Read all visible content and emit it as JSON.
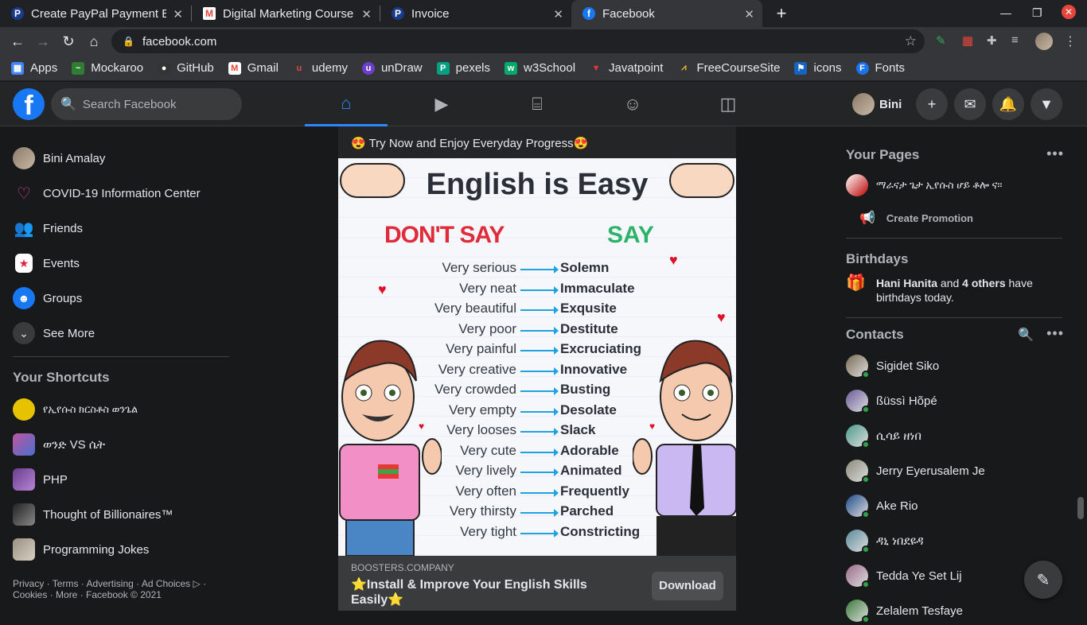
{
  "browser": {
    "tabs": [
      {
        "title": "Create PayPal Payment Bu",
        "icon": "paypal-icon",
        "color": "#ffffff",
        "glyph": "P"
      },
      {
        "title": "Digital Marketing Course",
        "icon": "gmail-icon",
        "color": "#ea4335",
        "glyph": "M"
      },
      {
        "title": "Invoice",
        "icon": "paypal-icon",
        "color": "#ffffff",
        "glyph": "P"
      },
      {
        "title": "Facebook",
        "icon": "facebook-icon",
        "color": "#1877f2",
        "glyph": "f"
      }
    ],
    "url": "facebook.com",
    "bookmarks": [
      {
        "label": "Apps",
        "icon": "apps-grid-icon",
        "color": "#4285f4",
        "glyph": "⋮"
      },
      {
        "label": "Mockaroo",
        "icon": "mockaroo-icon",
        "color": "#2e7d32",
        "glyph": "~"
      },
      {
        "label": "GitHub",
        "icon": "github-icon",
        "color": "#333333",
        "glyph": "●"
      },
      {
        "label": "Gmail",
        "icon": "gmail-icon",
        "color": "#ea4335",
        "glyph": "M"
      },
      {
        "label": "udemy",
        "icon": "udemy-icon",
        "color": "#c0392b",
        "glyph": "u"
      },
      {
        "label": "unDraw",
        "icon": "undraw-icon",
        "color": "#6c3fc9",
        "glyph": "u"
      },
      {
        "label": "pexels",
        "icon": "pexels-icon",
        "color": "#05a081",
        "glyph": "P"
      },
      {
        "label": "w3School",
        "icon": "w3school-icon",
        "color": "#04aa6d",
        "glyph": "w"
      },
      {
        "label": "Javatpoint",
        "icon": "javatpoint-icon",
        "color": "#c62828",
        "glyph": "▼"
      },
      {
        "label": "FreeCourseSite",
        "icon": "freecoursesite-icon",
        "color": "#444444",
        "glyph": "⩘"
      },
      {
        "label": "icons",
        "icon": "icons-flag-icon",
        "color": "#1565c0",
        "glyph": "▶"
      },
      {
        "label": "Fonts",
        "icon": "fonts-icon",
        "color": "#1a73e8",
        "glyph": "F"
      }
    ]
  },
  "fb": {
    "search_placeholder": "Search Facebook",
    "profile_name": "Bini"
  },
  "left": {
    "items": [
      {
        "label": "Bini Amalay",
        "icon": "avatar",
        "color": "#8a7a6a"
      },
      {
        "label": "COVID-19 Information Center",
        "icon": "covid-info-icon",
        "color": "#c13584"
      },
      {
        "label": "Friends",
        "icon": "friends-icon",
        "color": "#1877f2"
      },
      {
        "label": "Events",
        "icon": "events-icon",
        "color": "#e41e3f"
      },
      {
        "label": "Groups",
        "icon": "groups-icon",
        "color": "#1877f2"
      },
      {
        "label": "See More",
        "icon": "chevron-down-icon",
        "color": "#3a3b3c"
      }
    ],
    "shortcuts_title": "Your Shortcuts",
    "shortcuts": [
      {
        "label": "የኢየሱስ ክርስቶስ ወንጌል",
        "color": "#e6c200"
      },
      {
        "label": "ወንድ VS ሴት",
        "color": "#c0559e"
      },
      {
        "label": "PHP",
        "color": "#6a3e8f"
      },
      {
        "label": "Thought of Billionaires™",
        "color": "#555555"
      },
      {
        "label": "Programming Jokes",
        "color": "#9a8f80"
      }
    ],
    "footer": "Privacy · Terms · Advertising · Ad Choices ▷ · Cookies · More · Facebook © 2021"
  },
  "post": {
    "top_text": "😍 Try Now and Enjoy Everyday Progress😍",
    "image_title": "English is Easy",
    "dont_say": "DON'T SAY",
    "say": "SAY",
    "pairs": [
      {
        "a": "Very serious",
        "b": "Solemn"
      },
      {
        "a": "Very neat",
        "b": "Immaculate"
      },
      {
        "a": "Very beautiful",
        "b": "Exqusite"
      },
      {
        "a": "Very poor",
        "b": "Destitute"
      },
      {
        "a": "Very painful",
        "b": "Excruciating"
      },
      {
        "a": "Very creative",
        "b": "Innovative"
      },
      {
        "a": "Very crowded",
        "b": "Busting"
      },
      {
        "a": "Very empty",
        "b": "Desolate"
      },
      {
        "a": "Very looses",
        "b": "Slack"
      },
      {
        "a": "Very cute",
        "b": "Adorable"
      },
      {
        "a": "Very lively",
        "b": "Animated"
      },
      {
        "a": "Very often",
        "b": "Frequently"
      },
      {
        "a": "Very thirsty",
        "b": "Parched"
      },
      {
        "a": "Very tight",
        "b": "Constricting"
      }
    ],
    "source": "BOOSTERS.COMPANY",
    "headline": "⭐Install & Improve Your English Skills Easily⭐",
    "button": "Download"
  },
  "right": {
    "pages_title": "Your Pages",
    "page_name": "ማራናታ ጌታ ኢየሱስ ሆይ ቶሎ ና።",
    "create_promotion": "Create Promotion",
    "birthdays_title": "Birthdays",
    "birthday_name": "Hani Hanita",
    "birthday_and": " and ",
    "birthday_others": "4 others",
    "birthday_rest": " have birthdays today.",
    "contacts_title": "Contacts",
    "contacts": [
      {
        "name": "Sigidet Siko",
        "color": "#7a6a55"
      },
      {
        "name": "ßüssì Hõpé",
        "color": "#6a5a9a"
      },
      {
        "name": "ሲሳይ ዘነበ",
        "color": "#4a9a8a"
      },
      {
        "name": "Jerry Eyerusalem Je",
        "color": "#8a8a7a"
      },
      {
        "name": "Ake Rio",
        "color": "#1e4a8a"
      },
      {
        "name": "ዳኒ ነበደዩዳ",
        "color": "#5a8a9a"
      },
      {
        "name": "Tedda Ye Set Lij",
        "color": "#9a6a8a"
      },
      {
        "name": "Zelalem Tesfaye",
        "color": "#3a7a3a"
      }
    ]
  }
}
